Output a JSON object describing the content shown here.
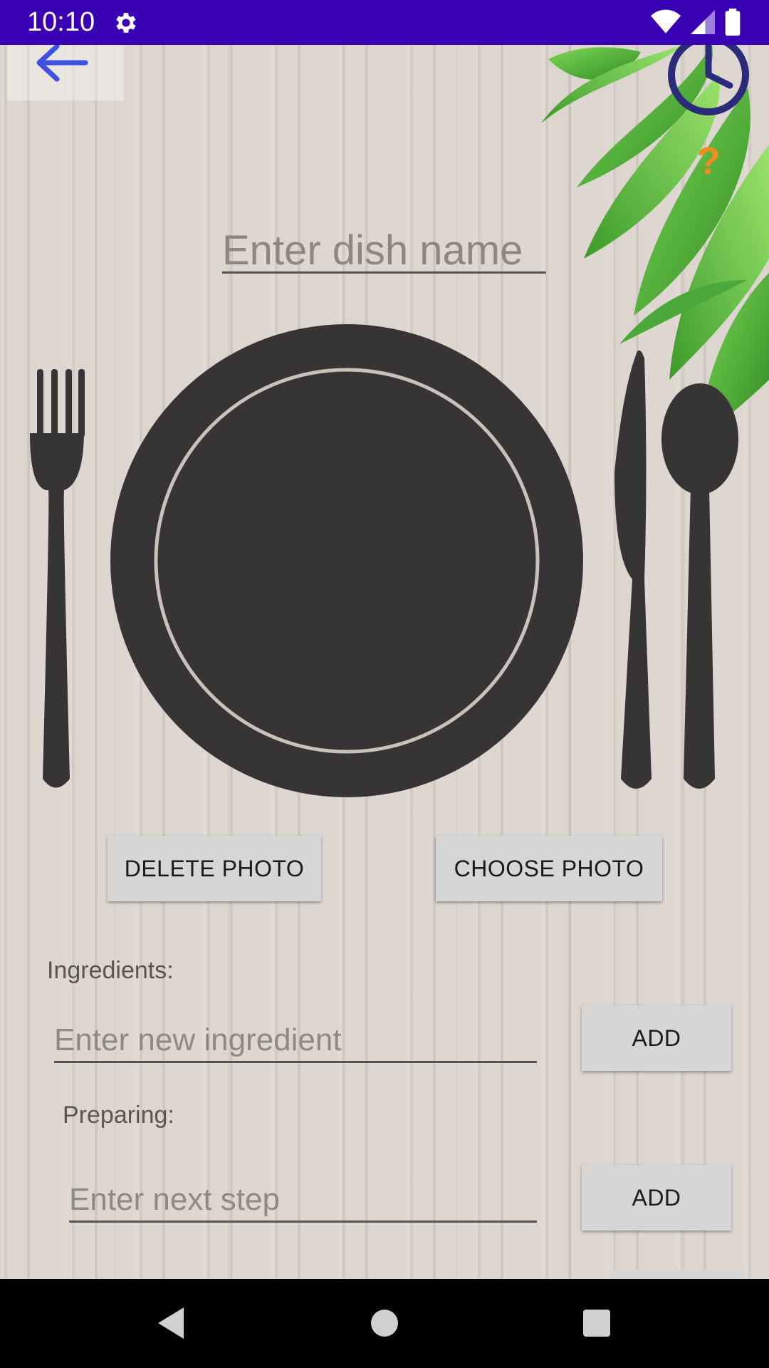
{
  "status_bar": {
    "time": "10:10",
    "icons": [
      "gear-icon",
      "wifi-icon",
      "signal-icon",
      "battery-icon"
    ],
    "background": "#3a00b4"
  },
  "toolbar": {
    "back_icon": "arrow-left-icon",
    "timer_icon": "clock-icon",
    "help_text": "?"
  },
  "dish": {
    "name_placeholder": "Enter dish name",
    "image": "plate-with-cutlery"
  },
  "photo_actions": {
    "delete_label": "DELETE PHOTO",
    "choose_label": "CHOOSE PHOTO"
  },
  "ingredients": {
    "label": "Ingredients:",
    "input_placeholder": "Enter new ingredient",
    "add_label": "ADD"
  },
  "preparing": {
    "label": "Preparing:",
    "input_placeholder": "Enter next step",
    "add_label": "ADD"
  },
  "nav_bar": {
    "icons": [
      "back-triangle-icon",
      "home-circle-icon",
      "recents-square-icon"
    ]
  },
  "colors": {
    "accent_blue": "#3f51e3",
    "help_orange": "#f58a1f",
    "tableware": "#373435"
  }
}
